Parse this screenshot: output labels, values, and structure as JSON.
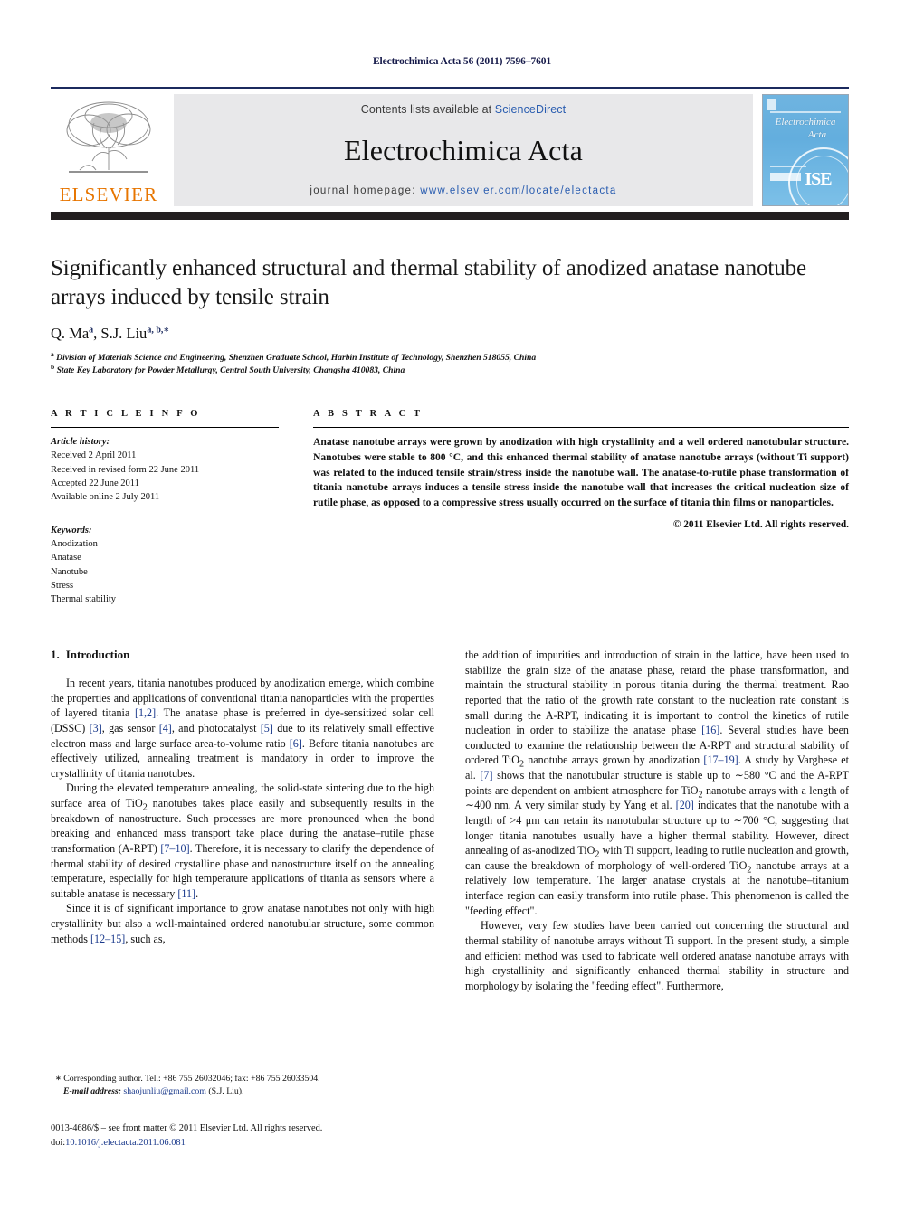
{
  "running_head": "Electrochimica Acta 56 (2011) 7596–7601",
  "masthead": {
    "contents_prefix": "Contents lists available at ",
    "sciencedirect": "ScienceDirect",
    "journal_name": "Electrochimica Acta",
    "homepage_label": "journal homepage: ",
    "homepage_url": "www.elsevier.com/locate/electacta",
    "publisher_logo_text": "ELSEVIER",
    "cover": {
      "title_line1": "Electrochimica",
      "title_line2": "Acta",
      "seal_text": "ISE"
    },
    "rule_color": "#1b2a5e",
    "band_color": "#e8e8ea",
    "dark_bar_color": "#231f20",
    "link_color": "#2a5db0",
    "elsevier_orange": "#e77500"
  },
  "title": "Significantly enhanced structural and thermal stability of anodized anatase nanotube arrays induced by tensile strain",
  "authors_html": "Q. Ma<sup>a</sup>, S.J. Liu<sup>a, b,</sup><sup>∗</sup>",
  "affiliations": [
    {
      "marker": "a",
      "text": "Division of Materials Science and Engineering, Shenzhen Graduate School, Harbin Institute of Technology, Shenzhen 518055, China"
    },
    {
      "marker": "b",
      "text": "State Key Laboratory for Powder Metallurgy, Central South University, Changsha 410083, China"
    }
  ],
  "article_info": {
    "heading": "A R T I C L E    I N F O",
    "history_label": "Article history:",
    "history": [
      "Received 2 April 2011",
      "Received in revised form 22 June 2011",
      "Accepted 22 June 2011",
      "Available online 2 July 2011"
    ],
    "keywords_label": "Keywords:",
    "keywords": [
      "Anodization",
      "Anatase",
      "Nanotube",
      "Stress",
      "Thermal stability"
    ]
  },
  "abstract": {
    "heading": "A B S T R A C T",
    "text": "Anatase nanotube arrays were grown by anodization with high crystallinity and a well ordered nanotubular structure. Nanotubes were stable to 800 °C, and this enhanced thermal stability of anatase nanotube arrays (without Ti support) was related to the induced tensile strain/stress inside the nanotube wall. The anatase-to-rutile phase transformation of titania nanotube arrays induces a tensile stress inside the nanotube wall that increases the critical nucleation size of rutile phase, as opposed to a compressive stress usually occurred on the surface of titania thin films or nanoparticles.",
    "copyright": "© 2011 Elsevier Ltd. All rights reserved."
  },
  "body": {
    "section_number": "1.",
    "section_title": "Introduction",
    "left_paragraphs": [
      "In recent years, titania nanotubes produced by anodization emerge, which combine the properties and applications of conventional titania nanoparticles with the properties of layered titania [1,2]. The anatase phase is preferred in dye-sensitized solar cell (DSSC) [3], gas sensor [4], and photocatalyst [5] due to its relatively small effective electron mass and large surface area-to-volume ratio [6]. Before titania nanotubes are effectively utilized, annealing treatment is mandatory in order to improve the crystallinity of titania nanotubes.",
      "During the elevated temperature annealing, the solid-state sintering due to the high surface area of TiO2 nanotubes takes place easily and subsequently results in the breakdown of nanostructure. Such processes are more pronounced when the bond breaking and enhanced mass transport take place during the anatase–rutile phase transformation (A-RPT) [7–10]. Therefore, it is necessary to clarify the dependence of thermal stability of desired crystalline phase and nanostructure itself on the annealing temperature, especially for high temperature applications of titania as sensors where a suitable anatase is necessary [11].",
      "Since it is of significant importance to grow anatase nanotubes not only with high crystallinity but also a well-maintained ordered nanotubular structure, some common methods [12–15], such as,"
    ],
    "right_paragraphs": [
      "the addition of impurities and introduction of strain in the lattice, have been used to stabilize the grain size of the anatase phase, retard the phase transformation, and maintain the structural stability in porous titania during the thermal treatment. Rao reported that the ratio of the growth rate constant to the nucleation rate constant is small during the A-RPT, indicating it is important to control the kinetics of rutile nucleation in order to stabilize the anatase phase [16]. Several studies have been conducted to examine the relationship between the A-RPT and structural stability of ordered TiO2 nanotube arrays grown by anodization [17–19]. A study by Varghese et al. [7] shows that the nanotubular structure is stable up to ~580 °C and the A-RPT points are dependent on ambient atmosphere for TiO2 nanotube arrays with a length of ~400 nm. A very similar study by Yang et al. [20] indicates that the nanotube with a length of >4 μm can retain its nanotubular structure up to ~700 °C, suggesting that longer titania nanotubes usually have a higher thermal stability. However, direct annealing of as-anodized TiO2 with Ti support, leading to rutile nucleation and growth, can cause the breakdown of morphology of well-ordered TiO2 nanotube arrays at a relatively low temperature. The larger anatase crystals at the nanotube–titanium interface region can easily transform into rutile phase. This phenomenon is called the \"feeding effect\".",
      "However, very few studies have been carried out concerning the structural and thermal stability of nanotube arrays without Ti support. In the present study, a simple and efficient method was used to fabricate well ordered anatase nanotube arrays with high crystallinity and significantly enhanced thermal stability in structure and morphology by isolating the \"feeding effect\". Furthermore,"
    ]
  },
  "footnotes": {
    "corresponding_star": "∗",
    "corresponding_text": "Corresponding author. Tel.: +86 755 26032046; fax: +86 755 26033504.",
    "email_label": "E-mail address:",
    "email": "shaojunliu@gmail.com",
    "email_suffix": "(S.J. Liu)."
  },
  "imprint": {
    "line1": "0013-4686/$ – see front matter © 2011 Elsevier Ltd. All rights reserved.",
    "doi_prefix": "doi:",
    "doi": "10.1016/j.electacta.2011.06.081"
  }
}
